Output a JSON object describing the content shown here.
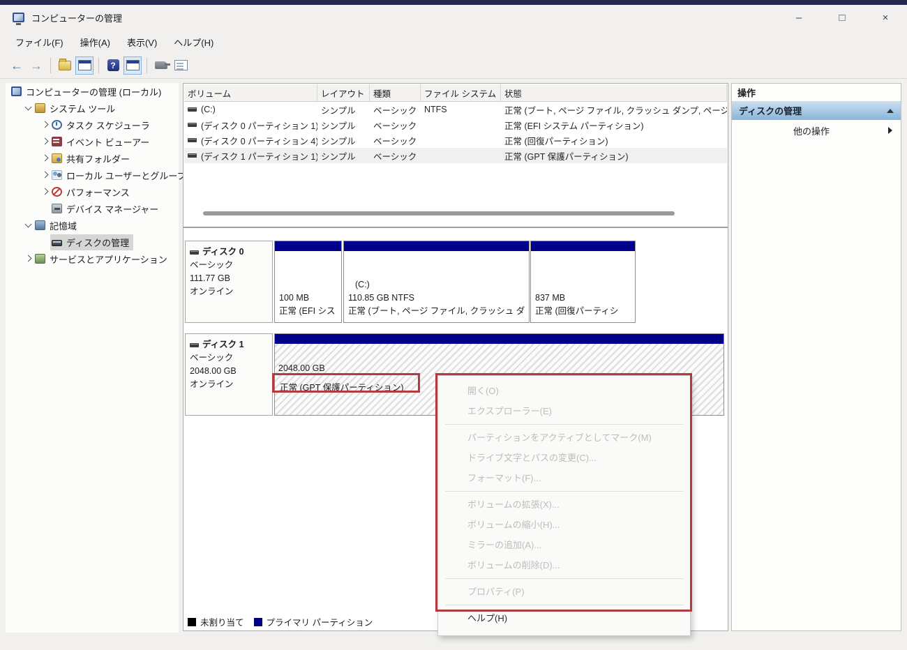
{
  "window": {
    "title": "コンピューターの管理",
    "minimize_glyph": "–",
    "maximize_glyph": "□",
    "close_glyph": "×"
  },
  "menu_bar": {
    "items": [
      "ファイル(F)",
      "操作(A)",
      "表示(V)",
      "ヘルプ(H)"
    ]
  },
  "sidebar": {
    "items": [
      {
        "label": "コンピューターの管理 (ローカル)",
        "icon": "computer-icon",
        "expander": "none"
      },
      {
        "label": "システム ツール",
        "icon": "system-tools-icon",
        "expander": "open"
      },
      {
        "label": "タスク スケジューラ",
        "icon": "task-scheduler-icon",
        "expander": "closed"
      },
      {
        "label": "イベント ビューアー",
        "icon": "event-viewer-icon",
        "expander": "closed"
      },
      {
        "label": "共有フォルダー",
        "icon": "shared-folders-icon",
        "expander": "closed"
      },
      {
        "label": "ローカル ユーザーとグループ",
        "icon": "local-users-icon",
        "expander": "closed"
      },
      {
        "label": "パフォーマンス",
        "icon": "performance-icon",
        "expander": "closed"
      },
      {
        "label": "デバイス マネージャー",
        "icon": "device-manager-icon",
        "expander": "none"
      },
      {
        "label": "記憶域",
        "icon": "storage-icon",
        "expander": "open"
      },
      {
        "label": "ディスクの管理",
        "icon": "disk-management-icon",
        "expander": "none",
        "selected": true
      },
      {
        "label": "サービスとアプリケーション",
        "icon": "services-icon",
        "expander": "closed"
      }
    ]
  },
  "volume_list": {
    "headers": [
      "ボリューム",
      "レイアウト",
      "種類",
      "ファイル システム",
      "状態"
    ],
    "rows": [
      {
        "volume": "(C:)",
        "layout": "シンプル",
        "type": "ベーシック",
        "fs": "NTFS",
        "status": "正常 (ブート, ページ ファイル, クラッシュ ダンプ, ページ"
      },
      {
        "volume": "(ディスク 0 パーティション 1)",
        "layout": "シンプル",
        "type": "ベーシック",
        "fs": "",
        "status": "正常 (EFI システム パーティション)"
      },
      {
        "volume": "(ディスク 0 パーティション 4)",
        "layout": "シンプル",
        "type": "ベーシック",
        "fs": "",
        "status": "正常 (回復パーティション)"
      },
      {
        "volume": "(ディスク 1 パーティション 1)",
        "layout": "シンプル",
        "type": "ベーシック",
        "fs": "",
        "status": "正常 (GPT 保護パーティション)",
        "selected": true
      }
    ]
  },
  "disks": [
    {
      "name": "ディスク 0",
      "type": "ベーシック",
      "size": "111.77 GB",
      "status": "オンライン",
      "partitions": [
        {
          "line1": "",
          "line2": "100 MB",
          "line3": "正常 (EFI シス"
        },
        {
          "line1": "(C:)",
          "line2": "110.85 GB NTFS",
          "line3": "正常 (ブート, ページ ファイル, クラッシュ ダ"
        },
        {
          "line1": "",
          "line2": "837 MB",
          "line3": "正常 (回復パーティシ"
        }
      ]
    },
    {
      "name": "ディスク 1",
      "type": "ベーシック",
      "size": "2048.00 GB",
      "status": "オンライン",
      "partitions": [
        {
          "line1": "2048.00 GB",
          "line2": "正常 (GPT 保護パーティション)"
        }
      ]
    }
  ],
  "legend": {
    "items": [
      {
        "label": "未割り当て",
        "color": "#000000"
      },
      {
        "label": "プライマリ パーティション",
        "color": "#00008b"
      }
    ]
  },
  "actions_panel": {
    "title": "操作",
    "group_label": "ディスクの管理",
    "sub_label": "他の操作"
  },
  "context_menu": {
    "items": [
      {
        "label": "開く(O)",
        "enabled": false
      },
      {
        "label": "エクスプローラー(E)",
        "enabled": false
      },
      {
        "label": "パーティションをアクティブとしてマーク(M)",
        "enabled": false
      },
      {
        "label": "ドライブ文字とパスの変更(C)...",
        "enabled": false
      },
      {
        "label": "フォーマット(F)...",
        "enabled": false
      },
      {
        "label": "ボリュームの拡張(X)...",
        "enabled": false
      },
      {
        "label": "ボリュームの縮小(H)...",
        "enabled": false
      },
      {
        "label": "ミラーの追加(A)...",
        "enabled": false
      },
      {
        "label": "ボリュームの削除(D)...",
        "enabled": false
      },
      {
        "label": "プロパティ(P)",
        "enabled": false
      },
      {
        "label": "ヘルプ(H)",
        "enabled": true
      }
    ]
  },
  "colors": {
    "partition_band_navy": "#00008b",
    "annotation_red": "#b23b42",
    "unallocated_black": "#000000",
    "primary_partition_navy": "#00008b",
    "actions_group_gradient_blue": "#8cb6da"
  }
}
